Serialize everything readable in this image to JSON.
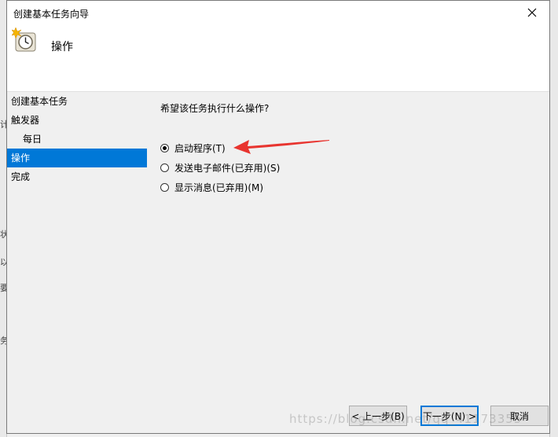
{
  "window": {
    "title": "创建基本任务向导",
    "close_glyph": "✕"
  },
  "header": {
    "title": "操作"
  },
  "nav": {
    "items": [
      {
        "label": "创建基本任务"
      },
      {
        "label": "触发器"
      },
      {
        "label": "每日"
      },
      {
        "label": "操作"
      },
      {
        "label": "完成"
      }
    ]
  },
  "main": {
    "question": "希望该任务执行什么操作?",
    "options": [
      {
        "label": "启动程序(T)",
        "checked": true
      },
      {
        "label": "发送电子邮件(已弃用)(S)",
        "checked": false
      },
      {
        "label": "显示消息(已弃用)(M)",
        "checked": false
      }
    ]
  },
  "buttons": {
    "back": "< 上一步(B)",
    "next": "下一步(N) >",
    "cancel": "取消"
  },
  "background": {
    "fragments": [
      "计",
      "状",
      "以",
      "要",
      "务"
    ]
  },
  "watermark": "https://blog.csdn.net/qq_41173355",
  "colors": {
    "selection": "#0078d7",
    "arrow": "#e8342f"
  }
}
